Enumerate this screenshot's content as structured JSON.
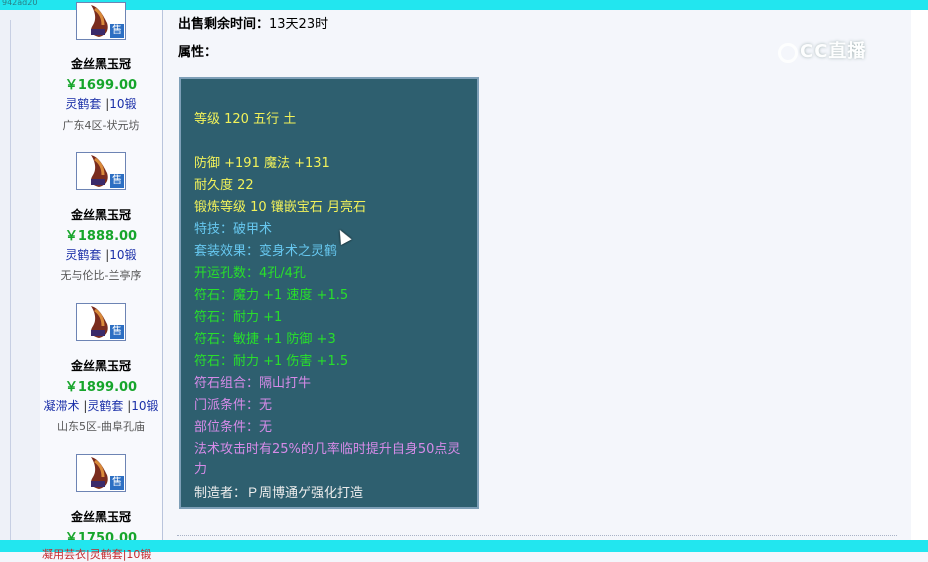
{
  "top_strip": {
    "text": "942ad20"
  },
  "listings": [
    {
      "name": "金丝黑玉冠",
      "price": "￥1699.00",
      "tags": [
        "灵鹤套",
        "10锻"
      ],
      "server": "广东4区-状元坊",
      "badge": "售"
    },
    {
      "name": "金丝黑玉冠",
      "price": "￥1888.00",
      "tags": [
        "灵鹤套",
        "10锻"
      ],
      "server": "无与伦比-兰亭序",
      "badge": "售"
    },
    {
      "name": "金丝黑玉冠",
      "price": "￥1899.00",
      "tags": [
        "凝滞术",
        "灵鹤套",
        "10锻"
      ],
      "server": "山东5区-曲阜孔庙",
      "badge": "售"
    },
    {
      "name": "金丝黑玉冠",
      "price": "￥1750.00",
      "tags": [],
      "server": "",
      "badge": "售"
    }
  ],
  "bottom_partial_text": "凝用芸衣|灵鹤套|10锻",
  "detail": {
    "remaining_label": "出售剩余时间：",
    "remaining_value": "13天23时",
    "attributes_label": "属性：",
    "lines": [
      {
        "text": "等级 120 五行 土",
        "color": "yellow"
      },
      {
        "text": "防御 +191 魔法 +131",
        "color": "yellow"
      },
      {
        "text": "耐久度 22",
        "color": "yellow"
      },
      {
        "text": "锻炼等级 10 镶嵌宝石 月亮石",
        "color": "yellow"
      },
      {
        "text": "特技：破甲术",
        "color": "cyan"
      },
      {
        "text": "套装效果：变身术之灵鹤",
        "color": "cyan"
      },
      {
        "text": "开运孔数：4孔/4孔",
        "color": "green"
      },
      {
        "text": "符石：魔力 +1 速度 +1.5",
        "color": "green"
      },
      {
        "text": "符石：耐力 +1",
        "color": "green"
      },
      {
        "text": "符石：敏捷 +1 防御 +3",
        "color": "green"
      },
      {
        "text": "符石：耐力 +1 伤害 +1.5",
        "color": "green"
      },
      {
        "text": "符石组合：隔山打牛",
        "color": "pink"
      },
      {
        "text": "门派条件：无",
        "color": "pink"
      },
      {
        "text": "部位条件：无",
        "color": "pink"
      },
      {
        "text": "法术攻击时有25%的几率临时提升自身50点灵力",
        "color": "pink"
      },
      {
        "text": "制造者：Ｐ周博通ゲ强化打造",
        "color": "white"
      }
    ]
  },
  "watermark": {
    "text": "CC直播"
  },
  "colors": {
    "accent_cyan": "#22e6ef",
    "attr_box_bg": "#2e5f6f",
    "price_green": "#16a52b",
    "yellow": "#f2f25a",
    "cyan": "#67c8f0",
    "green": "#28e02a",
    "pink": "#d68be8",
    "white": "#ededed"
  }
}
